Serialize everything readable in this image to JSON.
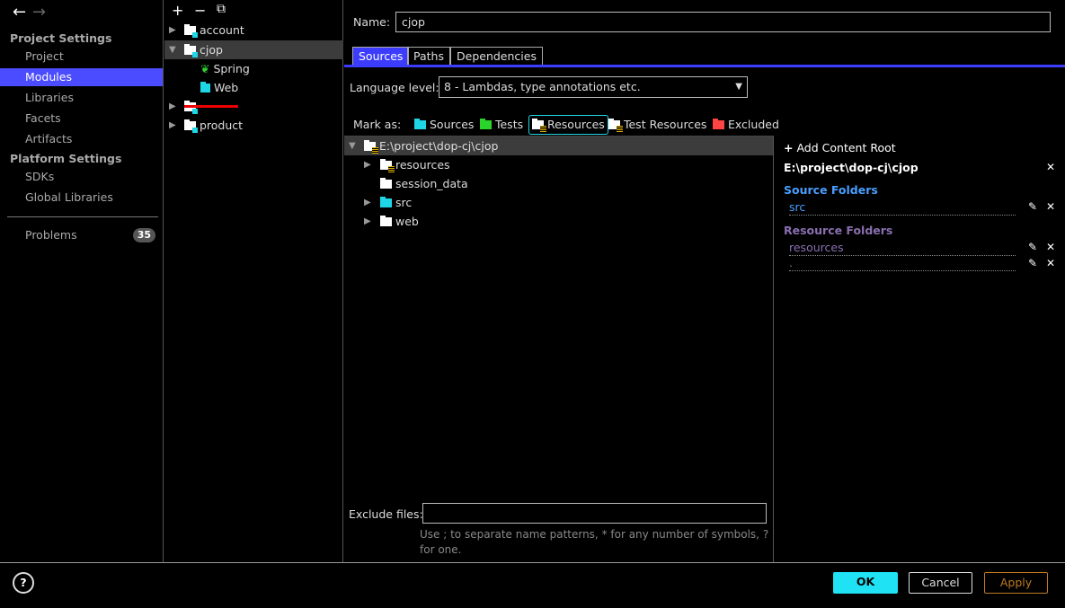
{
  "sidebar": {
    "back": "←",
    "forward": "→",
    "project_settings": "Project Settings",
    "items": [
      "Project",
      "Modules",
      "Libraries",
      "Facets",
      "Artifacts"
    ],
    "platform_settings": "Platform Settings",
    "platform_items": [
      "SDKs",
      "Global Libraries"
    ],
    "problems": "Problems",
    "problems_count": "35"
  },
  "modules": {
    "toolbar": {
      "add": "+",
      "remove": "−",
      "copy": "⧉"
    },
    "list": [
      "account",
      "cjop",
      "",
      "product"
    ],
    "facets": [
      "Spring",
      "Web"
    ]
  },
  "module": {
    "name_label": "Name:",
    "name_value": "cjop",
    "tabs": [
      "Sources",
      "Paths",
      "Dependencies"
    ],
    "active_tab": "Sources",
    "language_level_label": "Language level:",
    "language_level": "8 - Lambdas, type annotations etc.",
    "mark_as_label": "Mark as:",
    "mark_as": [
      "Sources",
      "Tests",
      "Resources",
      "Test Resources",
      "Excluded"
    ],
    "tree": {
      "root": "E:\\project\\dop-cj\\cjop",
      "children": [
        "resources",
        "session_data",
        "src",
        "web"
      ]
    },
    "exclude_label": "Exclude files:",
    "exclude_value": "",
    "exclude_hint": "Use ; to separate name patterns, * for any number of symbols, ? for one."
  },
  "content_root": {
    "add": "Add Content Root",
    "path": "E:\\project\\dop-cj\\cjop",
    "source_title": "Source Folders",
    "sources": [
      "src"
    ],
    "resource_title": "Resource Folders",
    "resources": [
      "resources",
      "."
    ]
  },
  "footer": {
    "help": "?",
    "ok": "OK",
    "cancel": "Cancel",
    "apply": "Apply"
  },
  "colors": {
    "accent": "#4b4bff",
    "ok": "#1fe3f5",
    "apply": "#c07a20",
    "source": "#4a9eff",
    "resource": "#8a6fb0"
  }
}
